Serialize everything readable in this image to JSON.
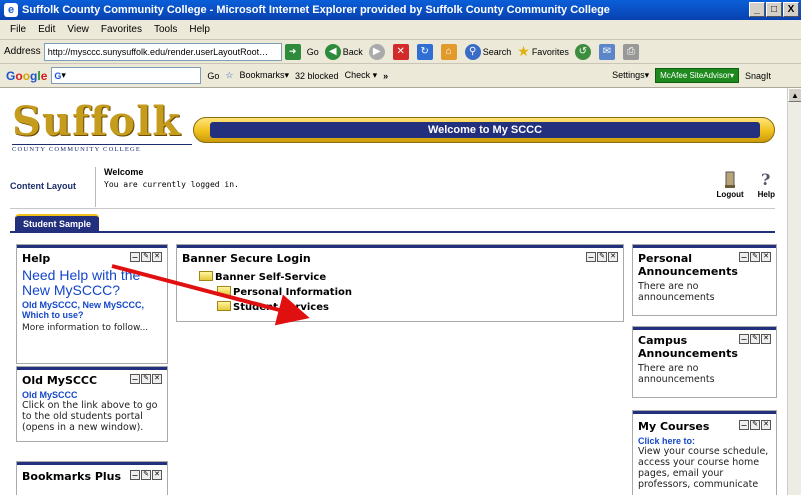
{
  "window": {
    "title": "Suffolk County Community College - Microsoft Internet Explorer provided by Suffolk County Community College",
    "controls": [
      "_",
      "□",
      "X"
    ]
  },
  "menu": [
    "File",
    "Edit",
    "View",
    "Favorites",
    "Tools",
    "Help"
  ],
  "address": {
    "label": "Address",
    "url": "http://mysccc.sunysuffolk.edu/render.userLayoutRoot…",
    "go": "Go",
    "back": "Back",
    "search": "Search",
    "favorites": "Favorites"
  },
  "google_toolbar": {
    "logo": "Google",
    "go": "Go",
    "bookmarks": "Bookmarks▾",
    "blocked": "32 blocked",
    "check": "Check ▾",
    "settings": "Settings▾",
    "mcafee": "McAfee SiteAdvisor▾",
    "snagit": "SnagIt"
  },
  "page": {
    "logo_word": "Suffolk",
    "logo_sub": "COUNTY COMMUNITY COLLEGE",
    "banner": "Welcome to My SCCC",
    "content_layout": "Content Layout",
    "welcome_title": "Welcome",
    "welcome_msg": "You are currently logged in.",
    "logout": "Logout",
    "help": "Help",
    "tab": "Student Sample"
  },
  "portlets": {
    "help": {
      "title": "Help",
      "heading": "Need Help with the New MySCCC?",
      "link": "Old MySCCC, New MySCCC, Which to use?",
      "text": "More information to follow..."
    },
    "old_mysccc": {
      "title": "Old MySCCC",
      "link": "Old MySCCC",
      "text": "Click on the link above to go to the old students portal (opens in a new window)."
    },
    "bookmarks": {
      "title": "Bookmarks Plus"
    },
    "banner_login": {
      "title": "Banner Secure Login",
      "root": "Banner Self-Service",
      "items": [
        "Personal Information",
        "Student Services"
      ]
    },
    "personal": {
      "title": "Personal Announcements",
      "text": "There are no announcements"
    },
    "campus": {
      "title": "Campus Announcements",
      "text": "There are no announcements"
    },
    "courses": {
      "title": "My Courses",
      "link": "Click here to:",
      "text": "View your course schedule, access your course home pages, email your professors, communicate"
    }
  }
}
